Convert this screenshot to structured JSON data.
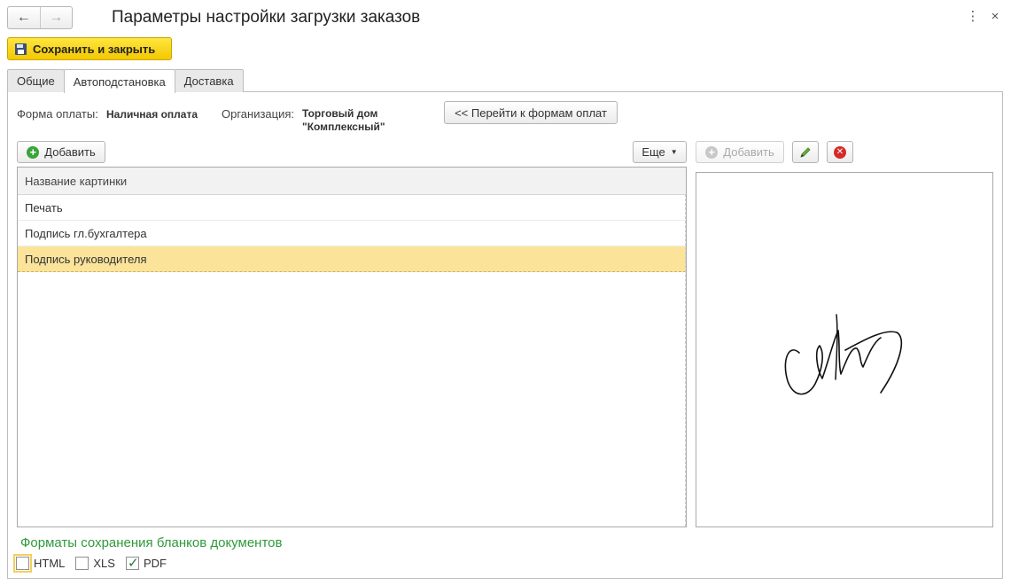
{
  "window": {
    "title": "Параметры настройки загрузки заказов",
    "back_icon": "←",
    "forward_icon": "→",
    "menu_icon": "⋮",
    "close_icon": "×"
  },
  "toolbar": {
    "save_label": "Сохранить и закрыть"
  },
  "tabs": [
    {
      "label": "Общие",
      "active": false
    },
    {
      "label": "Автоподстановка",
      "active": true
    },
    {
      "label": "Доставка",
      "active": false
    }
  ],
  "info": {
    "payment_form_label": "Форма оплаты:",
    "payment_form_value": "Наличная оплата",
    "organization_label": "Организация:",
    "organization_value": "Торговый дом \"Комплексный\"",
    "goto_button": "<< Перейти к формам оплат"
  },
  "list": {
    "add_button": "Добавить",
    "more_button": "Еще",
    "column_header": "Название картинки",
    "rows": [
      "Печать",
      "Подпись гл.бухгалтера",
      "Подпись руководителя"
    ],
    "selected_row": 2
  },
  "picture": {
    "add_button": "Добавить"
  },
  "formats": {
    "title": "Форматы сохранения бланков документов",
    "options": [
      {
        "label": "HTML",
        "checked": false
      },
      {
        "label": "XLS",
        "checked": false
      },
      {
        "label": "PDF",
        "checked": true
      }
    ]
  },
  "colors": {
    "accent_yellow": "#f2c800",
    "selection": "#fbe49a",
    "section_green": "#2e9a3a"
  }
}
